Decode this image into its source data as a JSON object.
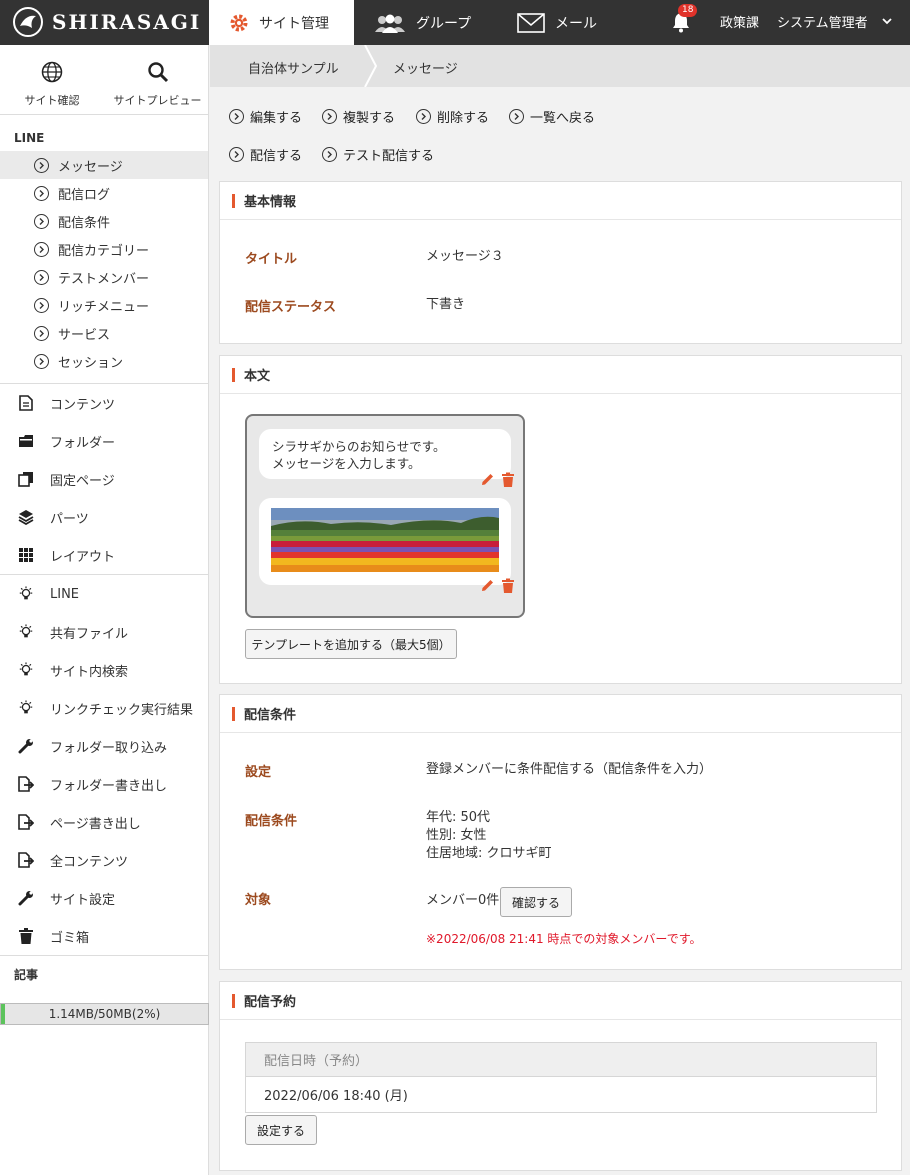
{
  "header": {
    "logo_text": "SHIRASAGI",
    "tabs": [
      {
        "label": "サイト管理",
        "icon": "gear-icon"
      },
      {
        "label": "グループ",
        "icon": "group-icon"
      },
      {
        "label": "メール",
        "icon": "mail-icon"
      }
    ],
    "notification_count": "18",
    "department": "政策課",
    "user": "システム管理者"
  },
  "sidebar": {
    "top_links": [
      {
        "label": "サイト確認",
        "icon": "globe-icon"
      },
      {
        "label": "サイトプレビュー",
        "icon": "search-icon"
      }
    ],
    "line_section_title": "LINE",
    "line_items": [
      {
        "label": "メッセージ"
      },
      {
        "label": "配信ログ"
      },
      {
        "label": "配信条件"
      },
      {
        "label": "配信カテゴリー"
      },
      {
        "label": "テストメンバー"
      },
      {
        "label": "リッチメニュー"
      },
      {
        "label": "サービス"
      },
      {
        "label": "セッション"
      }
    ],
    "menu_items": [
      {
        "label": "コンテンツ",
        "icon": "document-icon"
      },
      {
        "label": "フォルダー",
        "icon": "folder-icon"
      },
      {
        "label": "固定ページ",
        "icon": "pages-icon"
      },
      {
        "label": "パーツ",
        "icon": "layers-icon"
      },
      {
        "label": "レイアウト",
        "icon": "grid-icon"
      },
      {
        "label": "LINE",
        "icon": "lightbulb-icon"
      },
      {
        "label": "共有ファイル",
        "icon": "lightbulb-icon"
      },
      {
        "label": "サイト内検索",
        "icon": "lightbulb-icon"
      },
      {
        "label": "リンクチェック実行結果",
        "icon": "lightbulb-icon"
      },
      {
        "label": "フォルダー取り込み",
        "icon": "wrench-icon"
      },
      {
        "label": "フォルダー書き出し",
        "icon": "export-icon"
      },
      {
        "label": "ページ書き出し",
        "icon": "export-icon"
      },
      {
        "label": "全コンテンツ",
        "icon": "export-icon"
      },
      {
        "label": "サイト設定",
        "icon": "wrench-icon"
      },
      {
        "label": "ゴミ箱",
        "icon": "trash-icon"
      }
    ],
    "article_section_title": "記事",
    "storage": {
      "text": "1.14MB/50MB(2%)",
      "percent": 2
    }
  },
  "breadcrumb": [
    "自治体サンプル",
    "メッセージ"
  ],
  "actions": {
    "row1": [
      "編集する",
      "複製する",
      "削除する",
      "一覧へ戻る"
    ],
    "row2": [
      "配信する",
      "テスト配信する"
    ]
  },
  "basic_info": {
    "heading": "基本情報",
    "title_label": "タイトル",
    "title_value": "メッセージ３",
    "status_label": "配信ステータス",
    "status_value": "下書き"
  },
  "body_section": {
    "heading": "本文",
    "message_line1": "シラサギからのお知らせです。",
    "message_line2": "メッセージを入力します。",
    "add_template_button": "テンプレートを追加する（最大5個）"
  },
  "conditions": {
    "heading": "配信条件",
    "setting_label": "設定",
    "setting_value": "登録メンバーに条件配信する（配信条件を入力）",
    "cond_label": "配信条件",
    "cond_lines": [
      "年代: 50代",
      "性別: 女性",
      "住居地域: クロサギ町"
    ],
    "target_label": "対象",
    "target_value": "メンバー0件",
    "confirm_button": "確認する",
    "note": "※2022/06/08 21:41 時点での対象メンバーです。"
  },
  "schedule": {
    "heading": "配信予約",
    "column_header": "配信日時（予約）",
    "value": "2022/06/06 18:40 (月)",
    "set_button": "設定する"
  },
  "colors": {
    "topbar": "#333333",
    "accent": "#e4592f",
    "label": "#9c4a1f",
    "note_red": "#e0192b"
  }
}
